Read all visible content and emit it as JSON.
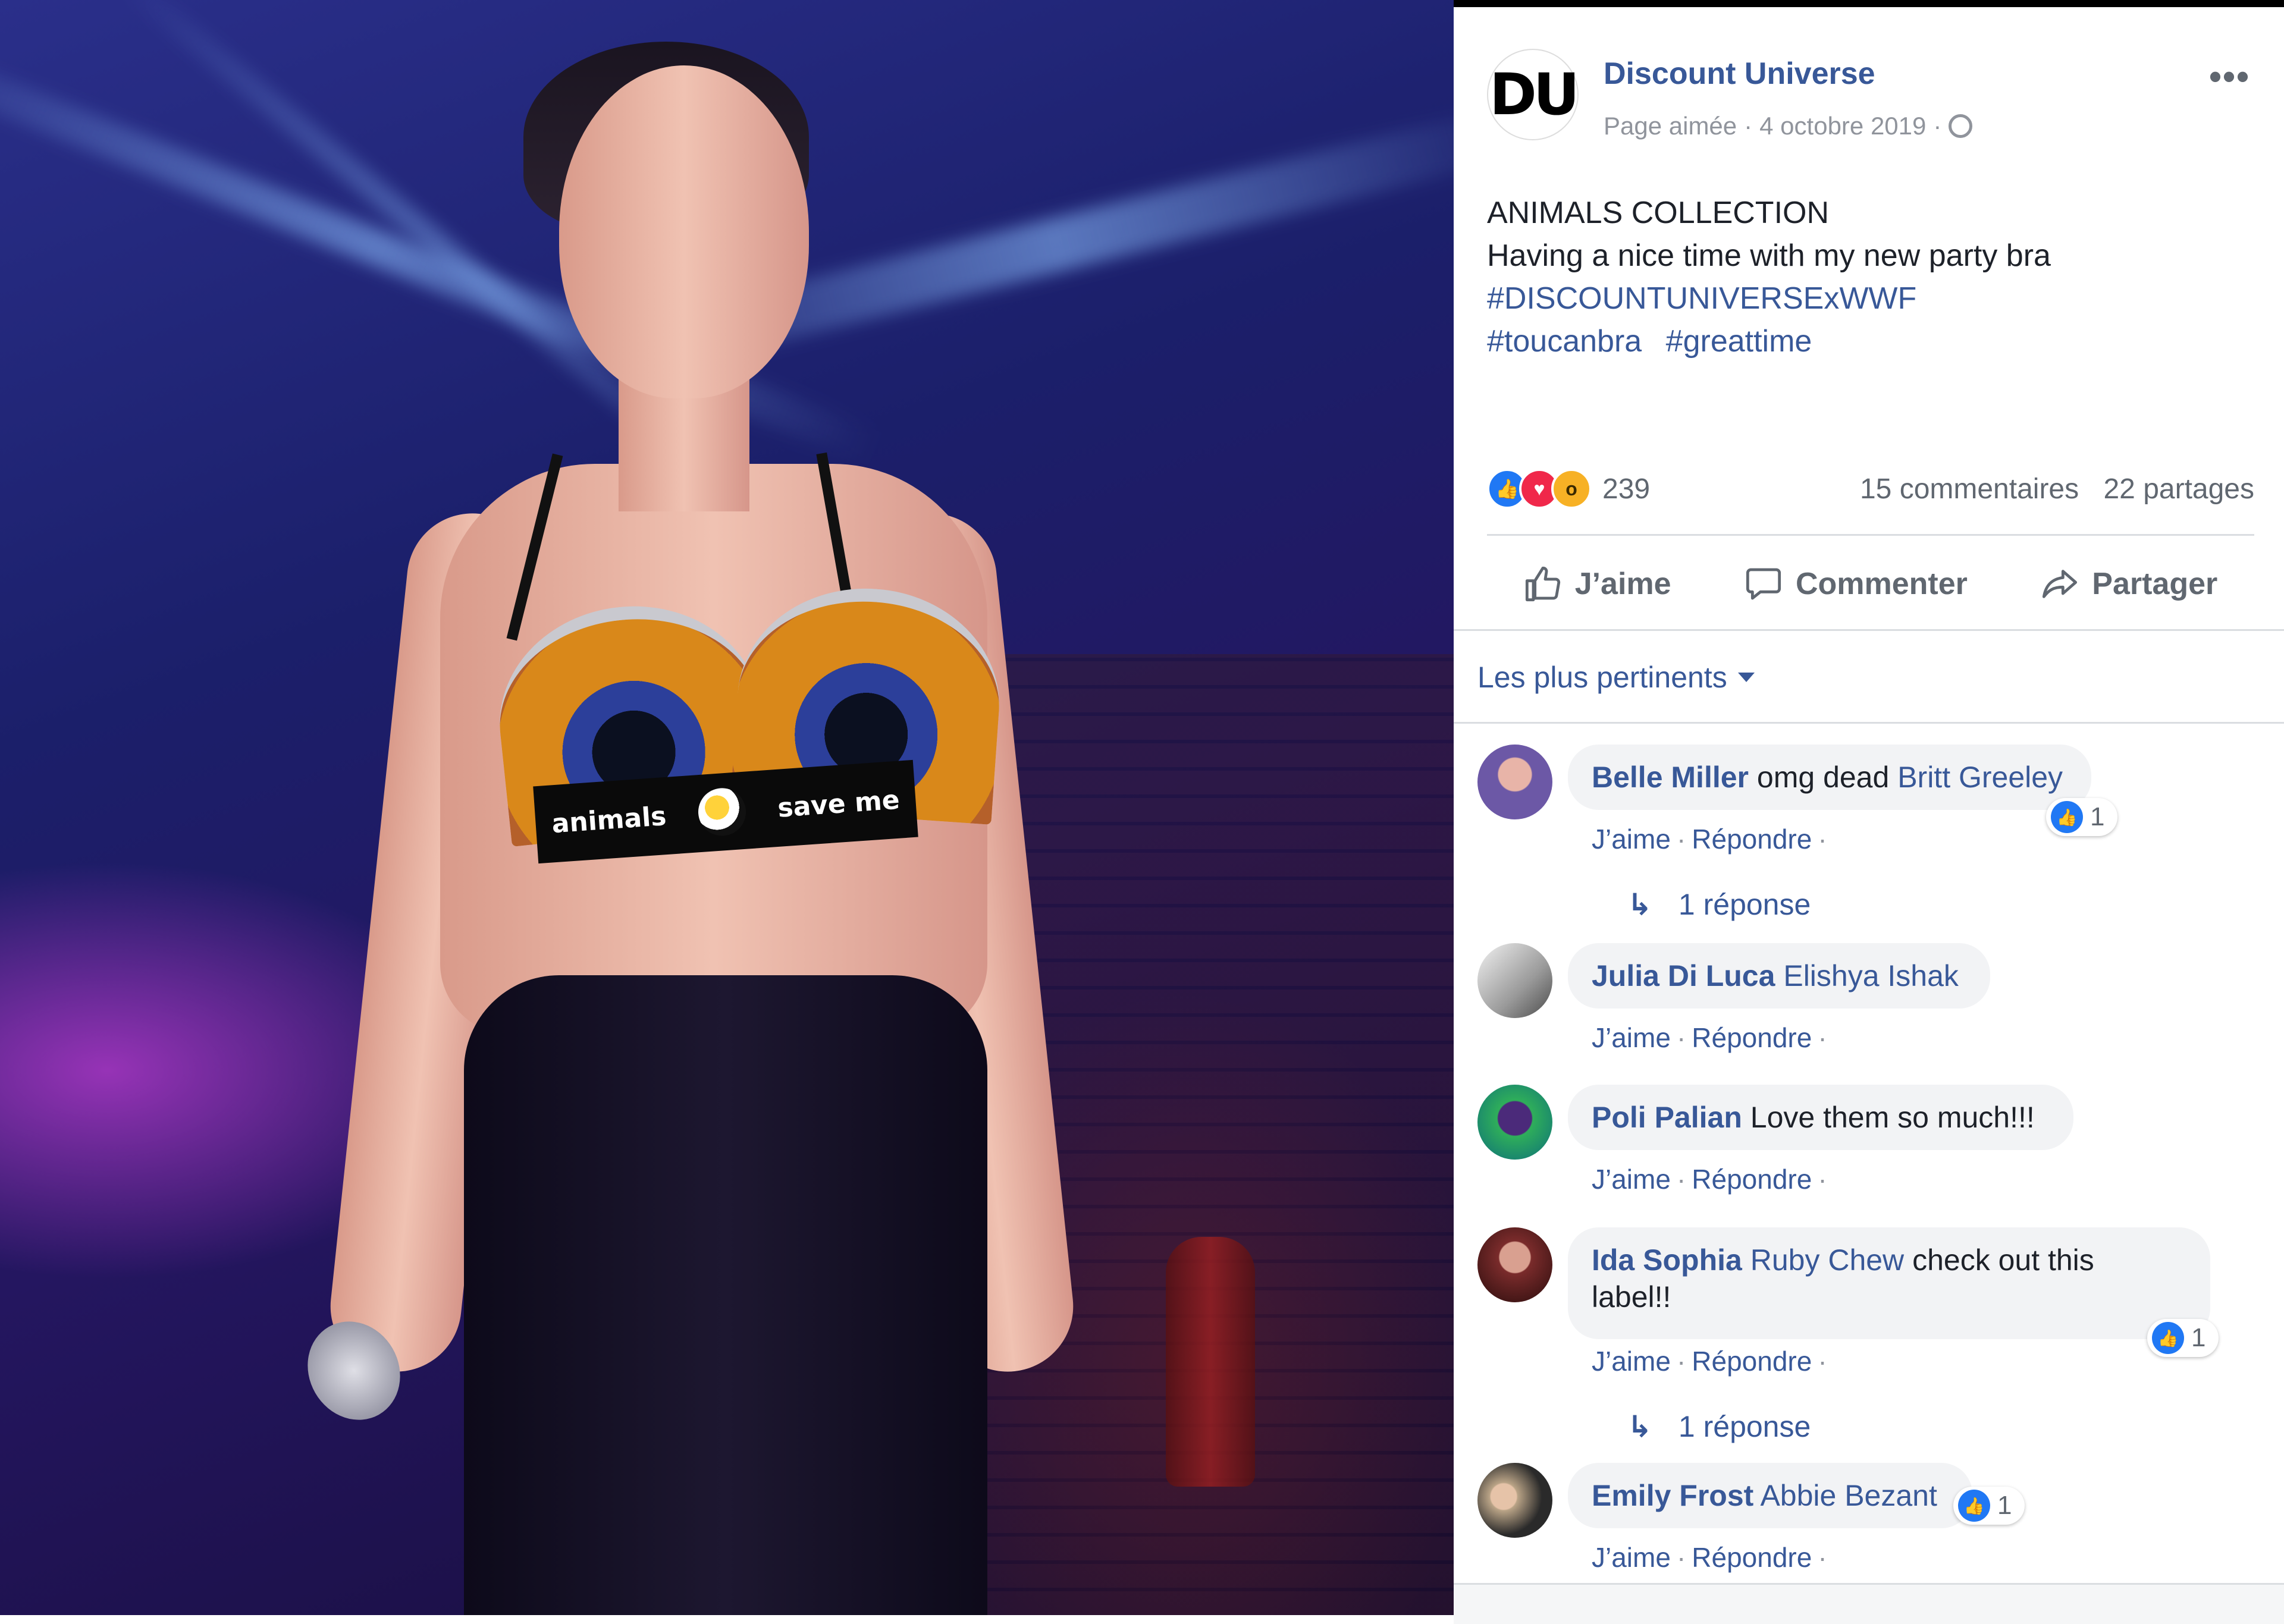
{
  "colors": {
    "link_blue": "#385898",
    "like_blue": "#2078f4",
    "love_red": "#f0284a",
    "wow_yellow": "#f7b125",
    "meta_grey": "#90949c"
  },
  "photo": {
    "band_brand": "animals",
    "band_slogan": "save me"
  },
  "post": {
    "page_name": "Discount Universe",
    "avatar_initials": "DU",
    "page_status": "Page aimée",
    "date": "4 octobre 2019",
    "separator": "·",
    "more_icon": "ellipsis-icon",
    "title_line": "ANIMALS COLLECTION",
    "body_line": "Having a nice time with my new party bra",
    "hashtags_line1": "#DISCOUNTUNIVERSExWWF",
    "hashtags_line2": [
      "#toucanbra",
      "#greattime"
    ]
  },
  "stats": {
    "reaction_count": "239",
    "comments": "15 commentaires",
    "shares": "22 partages",
    "reaction_icons": [
      "like-icon",
      "love-icon",
      "wow-icon"
    ]
  },
  "actions": {
    "like": "J’aime",
    "comment": "Commenter",
    "share": "Partager"
  },
  "sort": {
    "label": "Les plus pertinents"
  },
  "comment_meta": {
    "like": "J’aime",
    "reply": "Répondre",
    "dot": "·"
  },
  "comments": [
    {
      "author": "Belle Miller",
      "text": "omg dead",
      "mention": "Britt Greeley",
      "likes": "1",
      "replies": "1 réponse",
      "avatar_color": "#6c58a6"
    },
    {
      "author": "Julia Di Luca",
      "text": "",
      "mention": "Elishya Ishak",
      "avatar_color": "#8a8a8a"
    },
    {
      "author": "Poli Palian",
      "text": "Love them so much!!!",
      "mention": "",
      "avatar_color": "#2fae5a"
    },
    {
      "author": "Ida Sophia",
      "mention": "Ruby Chew",
      "text": "check out this",
      "text2": "label!!",
      "likes": "1",
      "replies": "1 réponse",
      "avatar_color": "#7a2b2b"
    },
    {
      "author": "Emily Frost",
      "mention": "Abbie Bezant",
      "text": "",
      "likes": "1",
      "avatar_color": "#b9a386"
    }
  ]
}
